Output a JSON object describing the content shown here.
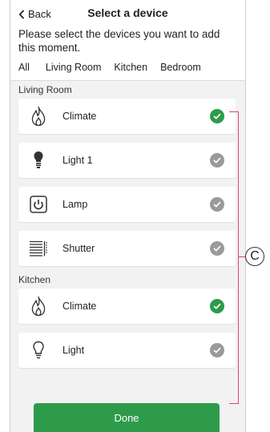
{
  "header": {
    "back_label": "Back",
    "title": "Select a device"
  },
  "description": "Please select the devices you want to add this moment.",
  "tabs": [
    {
      "label": "All",
      "active": true
    },
    {
      "label": "Living Room",
      "active": false
    },
    {
      "label": "Kitchen",
      "active": false
    },
    {
      "label": "Bedroom",
      "active": false
    }
  ],
  "sections": [
    {
      "label": "Living Room",
      "devices": [
        {
          "name": "Climate",
          "icon": "flame-icon",
          "selected": true
        },
        {
          "name": "Light 1",
          "icon": "bulb-icon",
          "selected": false
        },
        {
          "name": "Lamp",
          "icon": "power-socket-icon",
          "selected": false
        },
        {
          "name": "Shutter",
          "icon": "shutter-icon",
          "selected": false
        }
      ]
    },
    {
      "label": "Kitchen",
      "devices": [
        {
          "name": "Climate",
          "icon": "flame-icon",
          "selected": true
        },
        {
          "name": "Light",
          "icon": "bulb-outline-icon",
          "selected": false
        }
      ]
    }
  ],
  "done_label": "Done",
  "callout_label": "C",
  "colors": {
    "selected_check": "#2e9b4b",
    "unselected_check": "#9a9a9a",
    "done_button": "#2e9b4b",
    "bracket": "#e0406b"
  }
}
